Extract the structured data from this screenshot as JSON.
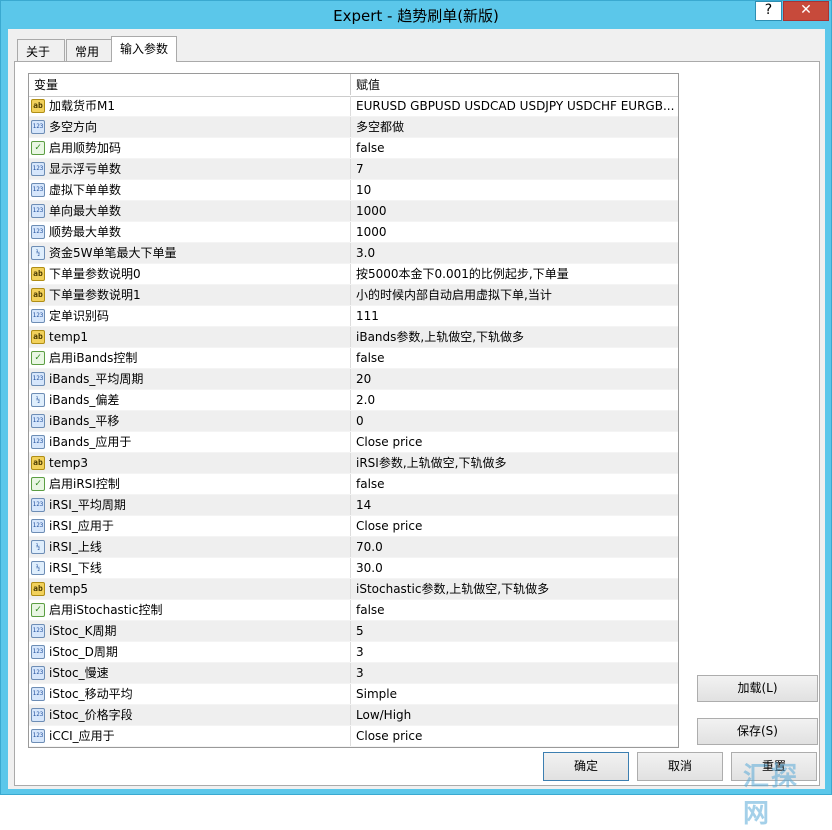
{
  "window": {
    "title": "Expert - 趋势刷单(新版)",
    "help": "?",
    "close": "✕"
  },
  "tabs": [
    {
      "label": "关于"
    },
    {
      "label": "常用"
    },
    {
      "label": "输入参数"
    }
  ],
  "grid": {
    "col_name": "变量",
    "col_value": "赋值",
    "rows": [
      {
        "icon": "ab",
        "name": "加载货币M1",
        "value": "EURUSD GBPUSD USDCAD USDJPY USDCHF  EURGB..."
      },
      {
        "icon": "123",
        "name": "多空方向",
        "value": "多空都做"
      },
      {
        "icon": "bool",
        "name": "启用顺势加码",
        "value": "false"
      },
      {
        "icon": "123",
        "name": "显示浮亏单数",
        "value": "7"
      },
      {
        "icon": "123",
        "name": "虚拟下单单数",
        "value": "10"
      },
      {
        "icon": "123",
        "name": "单向最大单数",
        "value": "1000"
      },
      {
        "icon": "123",
        "name": "顺势最大单数",
        "value": "1000"
      },
      {
        "icon": "half",
        "name": "资金5W单笔最大下单量",
        "value": "3.0"
      },
      {
        "icon": "ab",
        "name": "下单量参数说明0",
        "value": "按5000本金下0.001的比例起步,下单量"
      },
      {
        "icon": "ab",
        "name": "下单量参数说明1",
        "value": "小的时候内部自动启用虚拟下单,当计"
      },
      {
        "icon": "123",
        "name": "定单识别码",
        "value": "111"
      },
      {
        "icon": "ab",
        "name": "temp1",
        "value": "iBands参数,上轨做空,下轨做多"
      },
      {
        "icon": "bool",
        "name": "启用iBands控制",
        "value": "false"
      },
      {
        "icon": "123",
        "name": "iBands_平均周期",
        "value": "20"
      },
      {
        "icon": "half",
        "name": "iBands_偏差",
        "value": "2.0"
      },
      {
        "icon": "123",
        "name": "iBands_平移",
        "value": "0"
      },
      {
        "icon": "123",
        "name": "iBands_应用于",
        "value": "Close price"
      },
      {
        "icon": "ab",
        "name": "temp3",
        "value": "iRSI参数,上轨做空,下轨做多"
      },
      {
        "icon": "bool",
        "name": "启用iRSI控制",
        "value": "false"
      },
      {
        "icon": "123",
        "name": "iRSI_平均周期",
        "value": "14"
      },
      {
        "icon": "123",
        "name": "iRSI_应用于",
        "value": "Close price"
      },
      {
        "icon": "half",
        "name": "iRSI_上线",
        "value": "70.0"
      },
      {
        "icon": "half",
        "name": "iRSI_下线",
        "value": "30.0"
      },
      {
        "icon": "ab",
        "name": "temp5",
        "value": "iStochastic参数,上轨做空,下轨做多"
      },
      {
        "icon": "bool",
        "name": "启用iStochastic控制",
        "value": "false"
      },
      {
        "icon": "123",
        "name": "iStoc_K周期",
        "value": "5"
      },
      {
        "icon": "123",
        "name": "iStoc_D周期",
        "value": "3"
      },
      {
        "icon": "123",
        "name": "iStoc_慢速",
        "value": "3"
      },
      {
        "icon": "123",
        "name": "iStoc_移动平均",
        "value": "Simple"
      },
      {
        "icon": "123",
        "name": "iStoc_价格字段",
        "value": "Low/High"
      },
      {
        "icon": "123",
        "name": "iCCI_应用于",
        "value": "Close price"
      }
    ]
  },
  "buttons": {
    "load": "加载(L)",
    "save": "保存(S)",
    "ok": "确定",
    "cancel": "取消",
    "reset": "重置"
  },
  "icons": {
    "ab": "ab",
    "123": "123",
    "bool": "✓",
    "half": "½"
  },
  "watermark": "汇探网"
}
